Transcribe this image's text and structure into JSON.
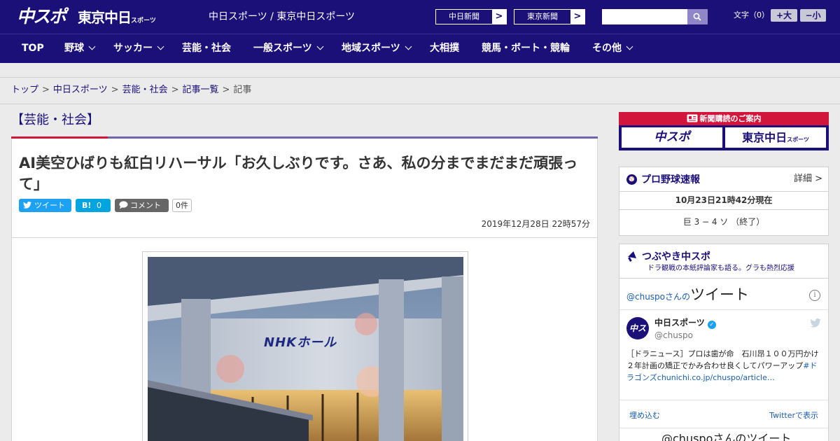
{
  "header": {
    "logo_chuspo": "中スポ",
    "logo_tokyo": "東京中日",
    "logo_tokyo_small": "スポーツ",
    "site_title": "中日スポーツ / 東京中日スポーツ",
    "links": [
      {
        "label": "中日新聞",
        "arrow": ">"
      },
      {
        "label": "東京新聞",
        "arrow": ">"
      }
    ],
    "search_placeholder": "",
    "fontsize_label": "文字（0）",
    "fontsize_up": "+大",
    "fontsize_down": "−小"
  },
  "nav": {
    "items": [
      {
        "label": "TOP"
      },
      {
        "label": "野球"
      },
      {
        "label": "サッカー"
      },
      {
        "label": "芸能・社会"
      },
      {
        "label": "一般スポーツ"
      },
      {
        "label": "地域スポーツ"
      },
      {
        "label": "大相撲"
      },
      {
        "label": "競馬・ボート・競輪"
      },
      {
        "label": "その他"
      }
    ]
  },
  "breadcrumb": {
    "items": [
      "トップ",
      "中日スポーツ",
      "芸能・社会",
      "記事一覧"
    ],
    "current": "記事",
    "sep": ">"
  },
  "article": {
    "category": "【芸能・社会】",
    "title": "AI美空ひばりも紅白リハーサル「お久しぶりです。さあ、私の分までまだまだ頑張って」",
    "share": {
      "tweet": "ツイート",
      "hatena_icon": "B!",
      "hatena_count": "0",
      "comment": "コメント",
      "comment_count": "0件"
    },
    "date": "2019年12月28日 22時57分",
    "photo_sign": "NHKホール"
  },
  "sidebar": {
    "ad": {
      "title": "新聞購読のご案内",
      "btn_chuspo": "中スポ",
      "btn_tokyo": "東京中日",
      "btn_tokyo_small": "スポーツ"
    },
    "baseball": {
      "title": "プロ野球速報",
      "detail": "詳細 >",
      "time": "10月23日21時42分現在",
      "score": "巨 3 − 4 ソ （終了）"
    },
    "tweets": {
      "title": "つぶやき中スポ",
      "subtitle": "ドラ観戦の本紙評論家も語る。グラも熱烈応援",
      "handle": "@chuspo",
      "handle_suffix": "さんの",
      "heading": "ツイート",
      "info": "i",
      "avatar": "中スポ",
      "name": "中日スポーツ",
      "verified": "✓",
      "user": "@chuspo",
      "text": "［ドラニュース］プロは歯が命　石川昂１００万円かけ２年計画の矯正でかみ合わせ良くしてパワーアップ",
      "hashtag": "#ドラゴンズ",
      "link": "chunichi.co.jp/chuspo/article…",
      "embed": "埋め込む",
      "view_on": "Twitterで表示",
      "next": "@chuspoさんのツイート"
    }
  },
  "colors": {
    "brand_navy": "#1b0f78",
    "accent_red": "#d2153a",
    "twitter_blue": "#1da1f2",
    "hatena_blue": "#00a4de"
  }
}
